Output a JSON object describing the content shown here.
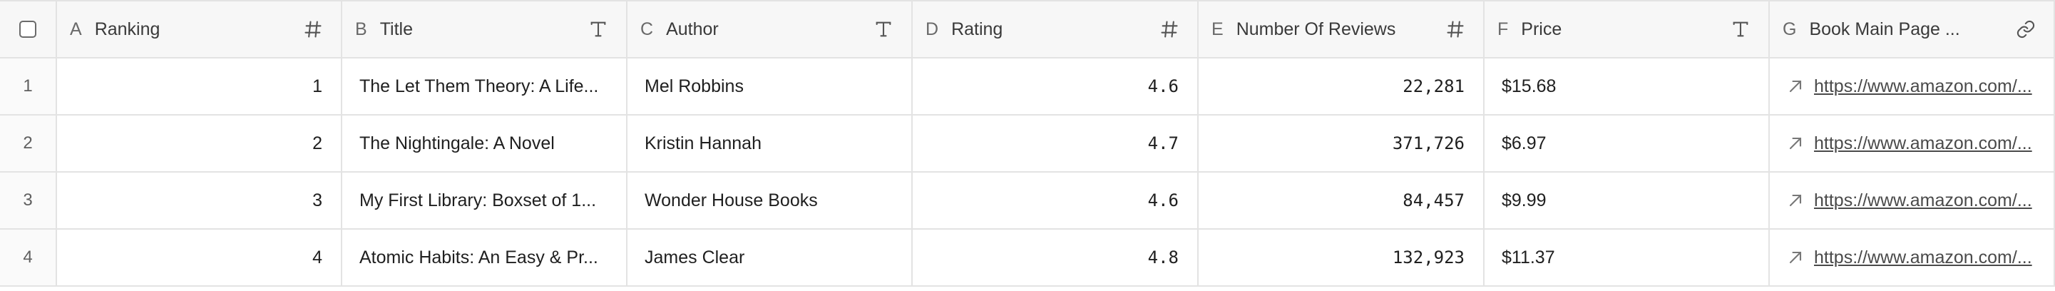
{
  "columns": [
    {
      "letter": "A",
      "name": "Ranking",
      "type_icon": "number-icon"
    },
    {
      "letter": "B",
      "name": "Title",
      "type_icon": "text-icon"
    },
    {
      "letter": "C",
      "name": "Author",
      "type_icon": "text-icon"
    },
    {
      "letter": "D",
      "name": "Rating",
      "type_icon": "number-icon"
    },
    {
      "letter": "E",
      "name": "Number Of Reviews",
      "type_icon": "number-icon"
    },
    {
      "letter": "F",
      "name": "Price",
      "type_icon": "text-icon"
    },
    {
      "letter": "G",
      "name": "Book Main Page ...",
      "type_icon": "link-icon"
    }
  ],
  "rows": [
    {
      "num": "1",
      "ranking": "1",
      "title": "The Let Them Theory: A Life...",
      "author": "Mel Robbins",
      "rating": "4.6",
      "reviews": "22,281",
      "price": "$15.68",
      "url": "https://www.amazon.com/..."
    },
    {
      "num": "2",
      "ranking": "2",
      "title": "The Nightingale: A Novel",
      "author": "Kristin Hannah",
      "rating": "4.7",
      "reviews": "371,726",
      "price": "$6.97",
      "url": "https://www.amazon.com/..."
    },
    {
      "num": "3",
      "ranking": "3",
      "title": "My First Library: Boxset of 1...",
      "author": "Wonder House Books",
      "rating": "4.6",
      "reviews": "84,457",
      "price": "$9.99",
      "url": "https://www.amazon.com/..."
    },
    {
      "num": "4",
      "ranking": "4",
      "title": "Atomic Habits: An Easy & Pr...",
      "author": "James Clear",
      "rating": "4.8",
      "reviews": "132,923",
      "price": "$11.37",
      "url": "https://www.amazon.com/..."
    }
  ]
}
